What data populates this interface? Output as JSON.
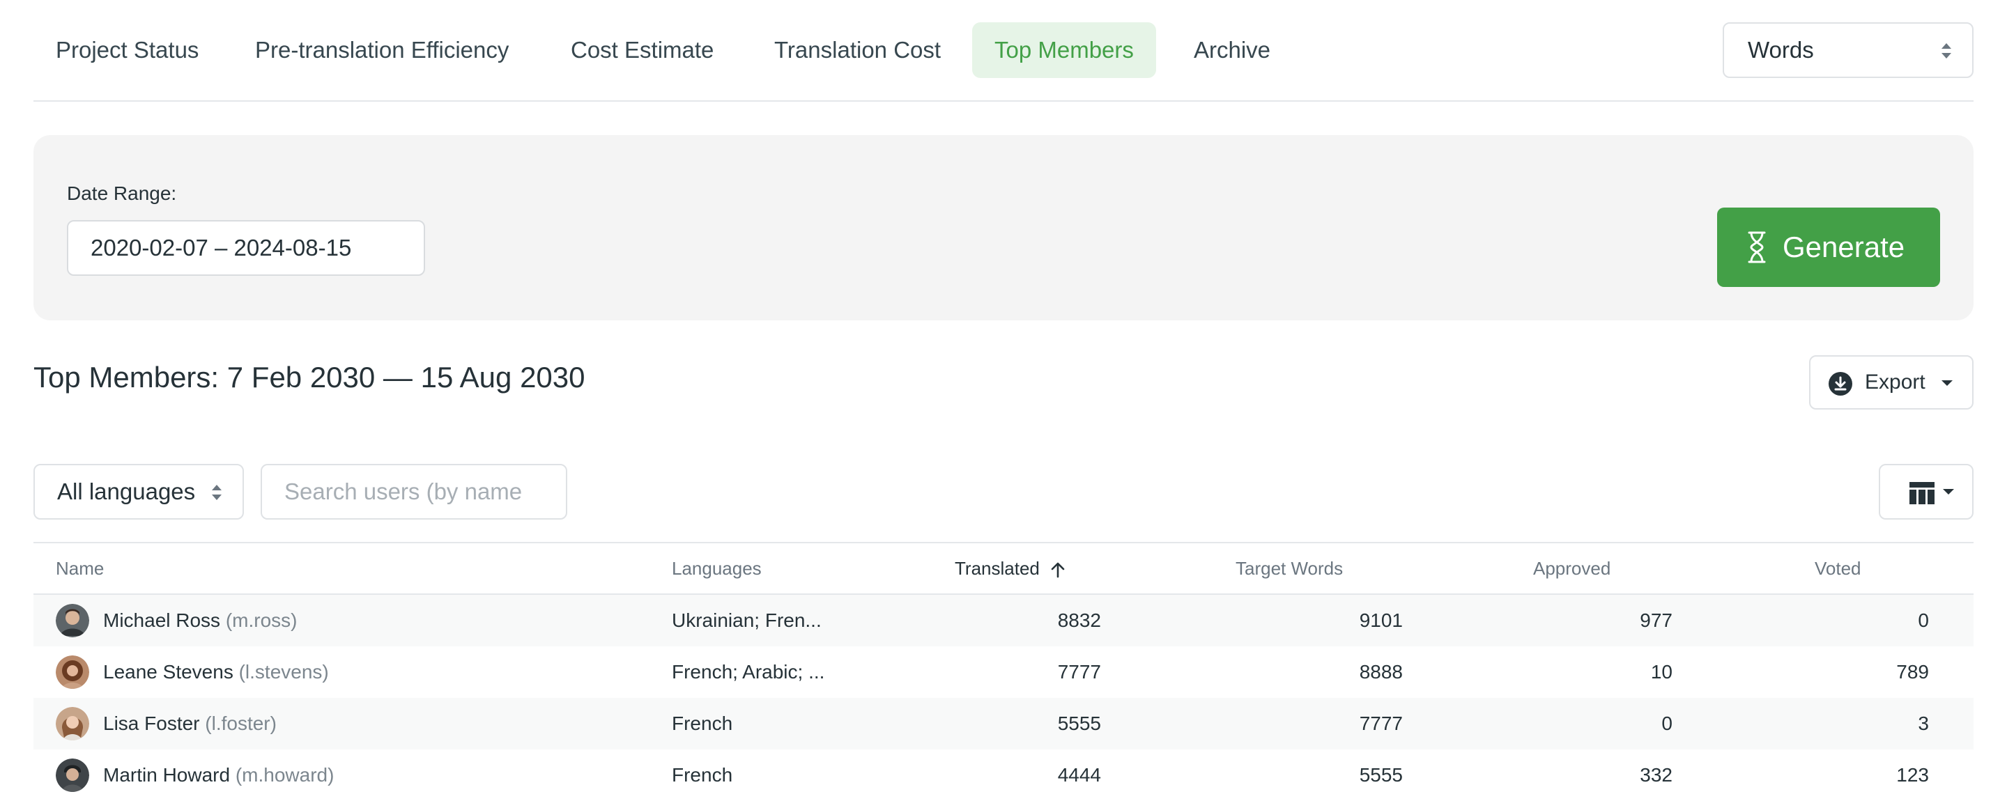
{
  "tabs": [
    {
      "label": "Project Status"
    },
    {
      "label": "Pre-translation Efficiency"
    },
    {
      "label": "Cost Estimate"
    },
    {
      "label": "Translation Cost"
    },
    {
      "label": "Top Members",
      "active": true
    },
    {
      "label": "Archive"
    }
  ],
  "unit_select": {
    "value": "Words"
  },
  "filters": {
    "date_range_label": "Date Range:",
    "date_range_value": "2020-02-07 – 2024-08-15",
    "generate_label": "Generate"
  },
  "report": {
    "title": "Top Members: 7 Feb 2030 — 15 Aug 2030",
    "export_label": "Export"
  },
  "toolbar": {
    "language_filter": "All languages",
    "search_placeholder": "Search users (by name"
  },
  "table": {
    "columns": [
      "Name",
      "Languages",
      "Translated",
      "Target Words",
      "Approved",
      "Voted"
    ],
    "sorted_column": "Translated",
    "sort_direction": "ascending",
    "rows": [
      {
        "name": "Michael Ross",
        "login": "(m.ross)",
        "languages": "Ukrainian; Fren...",
        "translated": "8832",
        "target_words": "9101",
        "approved": "977",
        "voted": "0"
      },
      {
        "name": "Leane Stevens",
        "login": "(l.stevens)",
        "languages": "French; Arabic; ...",
        "translated": "7777",
        "target_words": "8888",
        "approved": "10",
        "voted": "789"
      },
      {
        "name": "Lisa Foster",
        "login": "(l.foster)",
        "languages": "French",
        "translated": "5555",
        "target_words": "7777",
        "approved": "0",
        "voted": "3"
      },
      {
        "name": "Martin Howard",
        "login": "(m.howard)",
        "languages": "French",
        "translated": "4444",
        "target_words": "5555",
        "approved": "332",
        "voted": "123"
      }
    ]
  },
  "colors": {
    "accent": "#43a047",
    "active_tab_bg": "#e6f4e7",
    "panel_bg": "#f4f4f4"
  }
}
